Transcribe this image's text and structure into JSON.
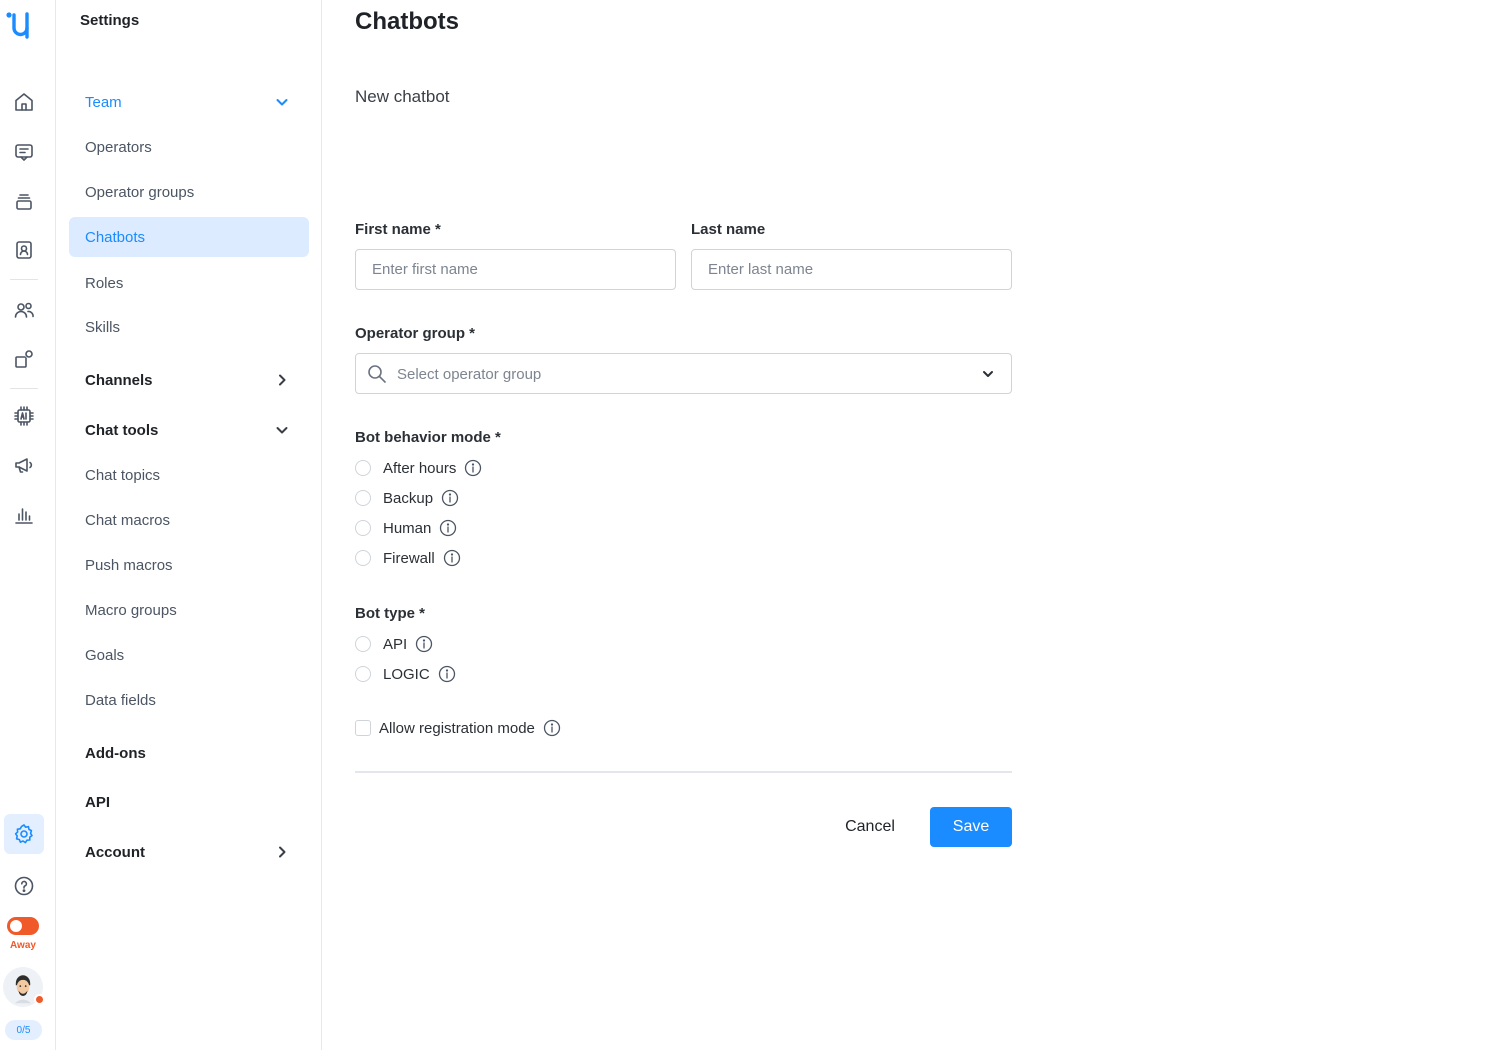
{
  "app": {
    "rail": {
      "logo_icon": "unitalk-logo-icon",
      "items": [
        {
          "icon": "home-icon"
        },
        {
          "icon": "chat-icon"
        },
        {
          "icon": "stack-icon"
        },
        {
          "icon": "contacts-icon"
        },
        {
          "icon": "people-icon"
        },
        {
          "icon": "integrations-icon"
        },
        {
          "icon": "ai-chip-icon"
        },
        {
          "icon": "megaphone-icon"
        },
        {
          "icon": "analytics-icon"
        },
        {
          "icon": "gear-icon"
        },
        {
          "icon": "help-icon"
        }
      ],
      "status_label": "Away",
      "status_color": "#f0592a",
      "chat_counter": "0/5"
    },
    "sidebar": {
      "title": "Settings",
      "team": "Team",
      "operators": "Operators",
      "operator_groups": "Operator groups",
      "chatbots": "Chatbots",
      "roles": "Roles",
      "skills": "Skills",
      "channels": "Channels",
      "chat_tools": "Chat tools",
      "chat_topics": "Chat topics",
      "chat_macros": "Chat macros",
      "push_macros": "Push macros",
      "macro_groups": "Macro groups",
      "goals": "Goals",
      "data_fields": "Data fields",
      "addons": "Add-ons",
      "api": "API",
      "account": "Account"
    },
    "main": {
      "title": "Chatbots",
      "subtitle": "New chatbot",
      "first_name_label": "First name *",
      "first_name_placeholder": "Enter first name",
      "first_name_value": "",
      "last_name_label": "Last name",
      "last_name_placeholder": "Enter last name",
      "last_name_value": "",
      "operator_group_label": "Operator group *",
      "operator_group_placeholder": "Select operator group",
      "behavior_label": "Bot behavior mode *",
      "behavior_options": [
        "After hours",
        "Backup",
        "Human",
        "Firewall"
      ],
      "bot_type_label": "Bot type *",
      "bot_type_options": [
        "API",
        "LOGIC"
      ],
      "registration_label": "Allow registration mode",
      "cancel": "Cancel",
      "save": "Save"
    },
    "colors": {
      "accent": "#1a8cff",
      "active_bg": "#dcebff",
      "status_away": "#f0592a"
    }
  }
}
